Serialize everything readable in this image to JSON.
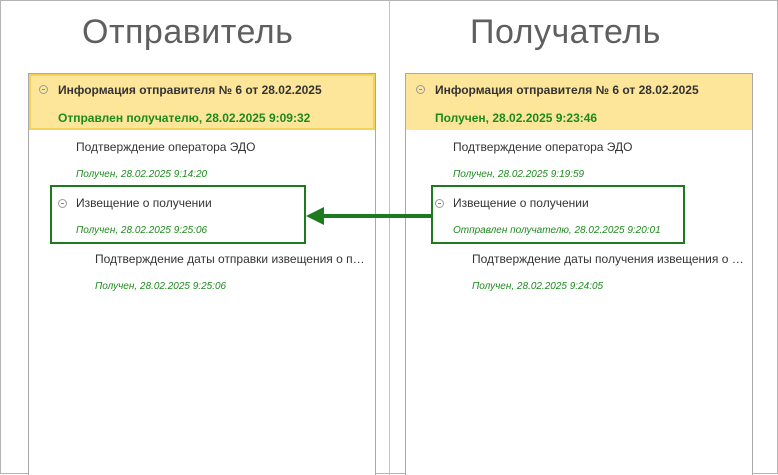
{
  "sender": {
    "heading": "Отправитель",
    "doc_title": "Информация отправителя № 6 от 28.02.2025",
    "doc_status": "Отправлен получателю, 28.02.2025 9:09:32",
    "operator_confirm": "Подтверждение оператора ЭДО",
    "operator_confirm_status": "Получен, 28.02.2025 9:14:20",
    "receipt_notice": "Извещение о получении",
    "receipt_notice_status": "Получен, 28.02.2025 9:25:06",
    "notice_confirm": "Подтверждение даты отправки извещения о получении",
    "notice_confirm_status": "Получен, 28.02.2025 9:25:06"
  },
  "receiver": {
    "heading": "Получатель",
    "doc_title": "Информация отправителя № 6 от 28.02.2025",
    "doc_status": "Получен, 28.02.2025 9:23:46",
    "operator_confirm": "Подтверждение оператора ЭДО",
    "operator_confirm_status": "Получен, 28.02.2025 9:19:59",
    "receipt_notice": "Извещение о получении",
    "receipt_notice_status": "Отправлен получателю, 28.02.2025 9:20:01",
    "notice_confirm": "Подтверждение даты получения извещения о получении",
    "notice_confirm_status": "Получен, 28.02.2025 9:24:05"
  },
  "icons": {
    "collapse": "collapse-toggle-icon",
    "arrow": "arrow-left-icon"
  },
  "colors": {
    "highlight_bg": "#fde69a",
    "status_green": "#1d8a1d",
    "frame_green": "#1e7a1e"
  }
}
